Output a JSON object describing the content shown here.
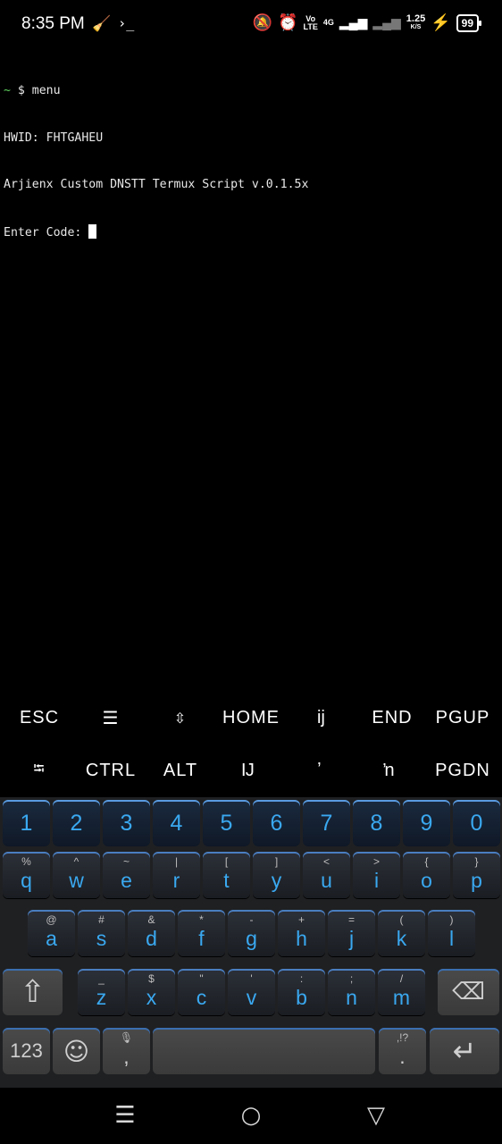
{
  "status_bar": {
    "time": "8:35 PM",
    "left_icons": [
      "broom-icon",
      "terminal-prompt-icon"
    ],
    "volte_top": "Vo",
    "volte_bottom": "LTE",
    "network": "4G",
    "speed_value": "1.25",
    "speed_unit": "K/S",
    "battery": "99"
  },
  "terminal": {
    "prompt_tilde": "~",
    "command_line": " $ menu",
    "lines": [
      "HWID: FHTGAHEU",
      "Arjienx Custom DNSTT Termux Script v.0.1.5x"
    ],
    "input_prompt": "Enter Code: "
  },
  "extra_keys": {
    "row1": [
      "ESC",
      "☰",
      "⇳",
      "HOME",
      "ĳ",
      "END",
      "PGUP"
    ],
    "row2": [
      "⭾",
      "CTRL",
      "ALT",
      "Ĳ",
      "ʼ",
      "ŉ",
      "PGDN"
    ]
  },
  "keyboard": {
    "numbers": [
      "1",
      "2",
      "3",
      "4",
      "5",
      "6",
      "7",
      "8",
      "9",
      "0"
    ],
    "row_q": [
      {
        "main": "q",
        "alt": "%"
      },
      {
        "main": "w",
        "alt": "^"
      },
      {
        "main": "e",
        "alt": "~"
      },
      {
        "main": "r",
        "alt": "|"
      },
      {
        "main": "t",
        "alt": "["
      },
      {
        "main": "y",
        "alt": "]"
      },
      {
        "main": "u",
        "alt": "<"
      },
      {
        "main": "i",
        "alt": ">"
      },
      {
        "main": "o",
        "alt": "{"
      },
      {
        "main": "p",
        "alt": "}"
      }
    ],
    "row_a": [
      {
        "main": "a",
        "alt": "@"
      },
      {
        "main": "s",
        "alt": "#"
      },
      {
        "main": "d",
        "alt": "&"
      },
      {
        "main": "f",
        "alt": "*"
      },
      {
        "main": "g",
        "alt": "-"
      },
      {
        "main": "h",
        "alt": "+"
      },
      {
        "main": "j",
        "alt": "="
      },
      {
        "main": "k",
        "alt": "("
      },
      {
        "main": "l",
        "alt": ")"
      }
    ],
    "row_z": [
      {
        "main": "z",
        "alt": "_"
      },
      {
        "main": "x",
        "alt": "$"
      },
      {
        "main": "c",
        "alt": "\""
      },
      {
        "main": "v",
        "alt": "'"
      },
      {
        "main": "b",
        "alt": ":"
      },
      {
        "main": "n",
        "alt": ";"
      },
      {
        "main": "m",
        "alt": "/"
      }
    ],
    "symbols_label": "123",
    "comma": ",",
    "period": ".",
    "period_alt": ",!?",
    "accent_color": "#3aa8f0"
  },
  "nav": {
    "icons": [
      "recents-icon",
      "home-icon",
      "back-icon"
    ]
  }
}
